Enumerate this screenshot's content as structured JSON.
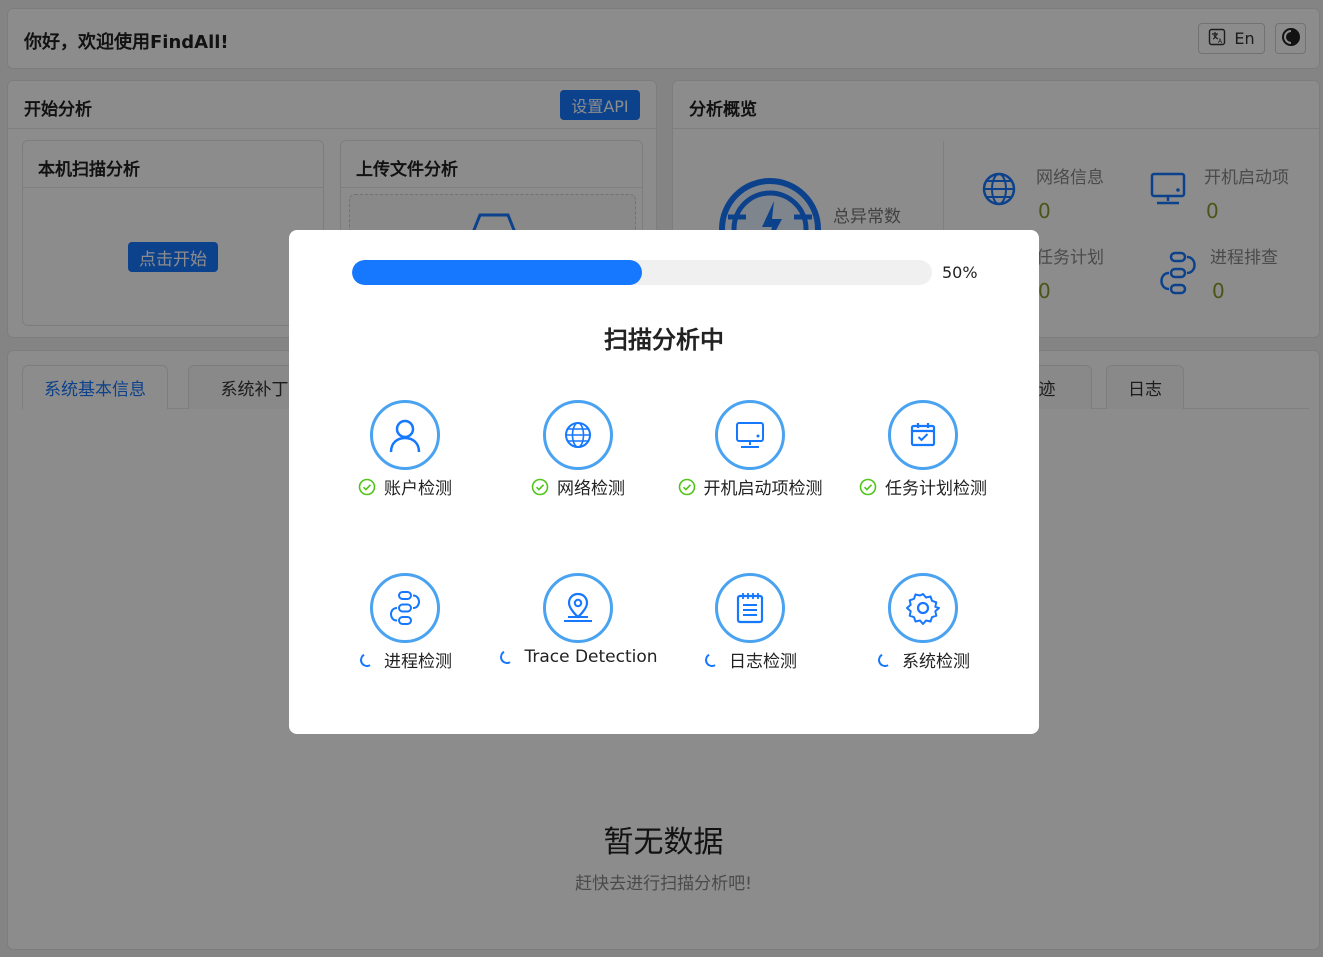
{
  "header": {
    "greeting": "你好，欢迎使用FindAll!",
    "lang_label": "En"
  },
  "start": {
    "title": "开始分析",
    "set_api": "设置API",
    "local_title": "本机扫描分析",
    "start_button": "点击开始",
    "upload_title": "上传文件分析"
  },
  "overview": {
    "title": "分析概览",
    "total_label": "总异常数",
    "stats": [
      {
        "label": "网络信息",
        "value": "0",
        "icon": "globe-icon"
      },
      {
        "label": "开机启动项",
        "value": "0",
        "icon": "monitor-icon"
      },
      {
        "label": "任务计划",
        "value": "0",
        "icon": "calendar-icon"
      },
      {
        "label": "进程排查",
        "value": "0",
        "icon": "process-icon"
      }
    ]
  },
  "tabs": [
    "系统基本信息",
    "系统补丁信",
    "迹",
    "日志"
  ],
  "empty": {
    "title": "暂无数据",
    "subtitle": "赶快去进行扫描分析吧!"
  },
  "modal": {
    "progress_percent": 50,
    "progress_text": "50%",
    "title": "扫描分析中",
    "items": [
      {
        "label": "账户检测",
        "status": "done",
        "icon": "user-icon"
      },
      {
        "label": "网络检测",
        "status": "done",
        "icon": "globe-icon"
      },
      {
        "label": "开机启动项检测",
        "status": "done",
        "icon": "monitor-icon"
      },
      {
        "label": "任务计划检测",
        "status": "done",
        "icon": "calendar-check-icon"
      },
      {
        "label": "进程检测",
        "status": "loading",
        "icon": "process-icon"
      },
      {
        "label": "Trace Detection",
        "status": "loading",
        "icon": "location-pin-icon"
      },
      {
        "label": "日志检测",
        "status": "loading",
        "icon": "notepad-icon"
      },
      {
        "label": "系统检测",
        "status": "loading",
        "icon": "gear-icon"
      }
    ]
  },
  "colors": {
    "primary": "#1677ff",
    "icon_blue": "#4aa3f0",
    "success": "#52c41a",
    "stat_value": "#8a9a2a"
  }
}
